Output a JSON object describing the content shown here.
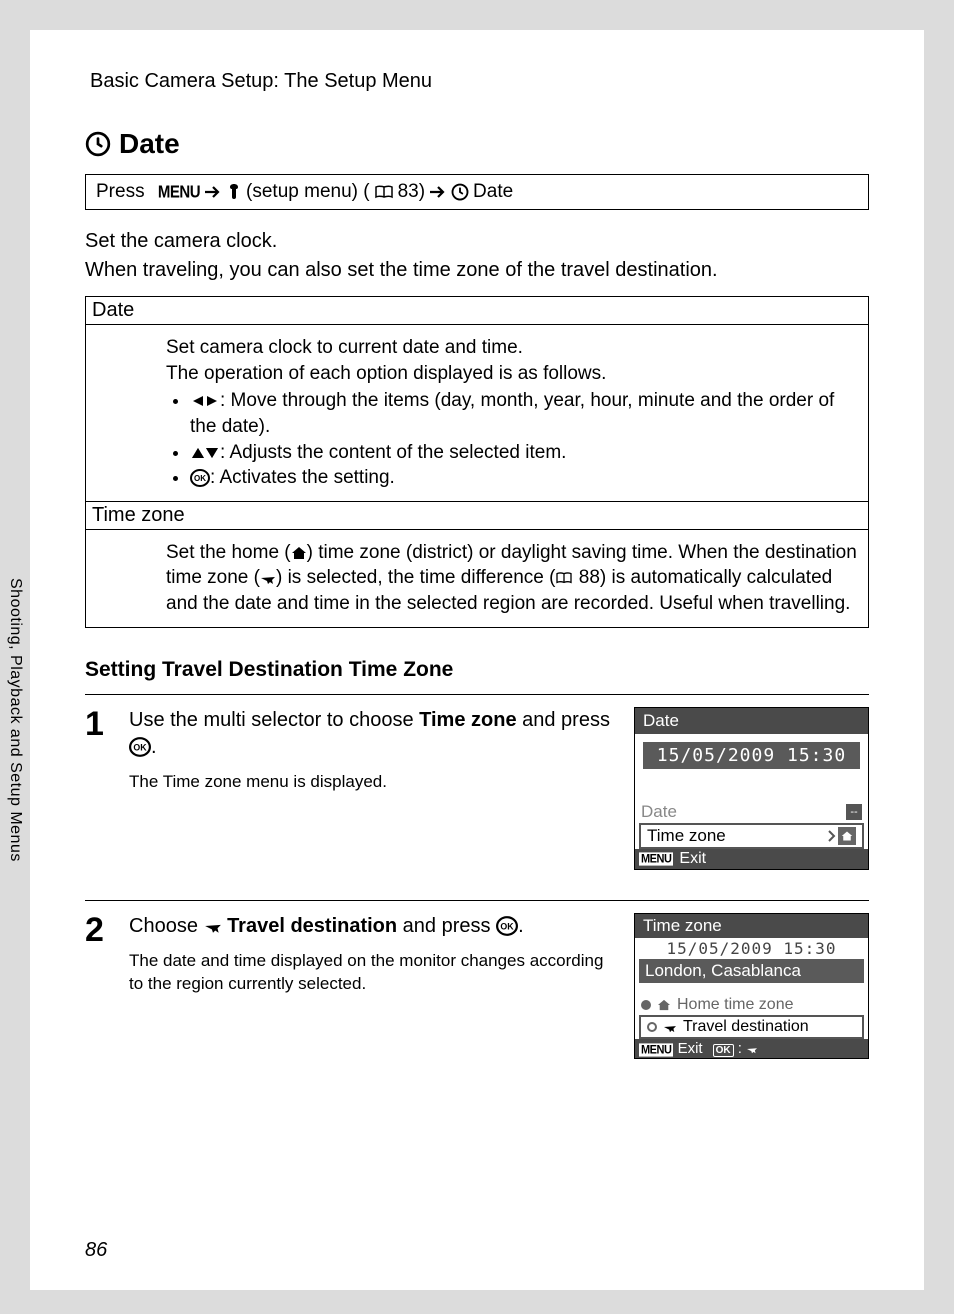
{
  "breadcrumb": "Basic Camera Setup: The Setup Menu",
  "h1": "Date",
  "nav": {
    "press": "Press",
    "menu": "MENU",
    "setup_menu": "(setup menu) (",
    "pageref": "83)",
    "date": "Date"
  },
  "intro1": "Set the camera clock.",
  "intro2": "When traveling, you can also set the time zone of the travel destination.",
  "table": {
    "row1": {
      "header": "Date",
      "p1": "Set camera clock to current date and time.",
      "p2": "The operation of each option displayed is as follows.",
      "li1": ": Move through the items (day, month, year, hour, minute and the order of the date).",
      "li2": ": Adjusts the content of the selected item.",
      "li3": ": Activates the setting."
    },
    "row2": {
      "header": "Time zone",
      "p1a": "Set the home (",
      "p1b": ") time zone (district) or daylight saving time. When the destination time zone (",
      "p1c": ") is selected, the time difference (",
      "p1d": "88) is automatically calculated and the date and time in the selected region are recorded. Useful when travelling."
    }
  },
  "sub_heading": "Setting Travel Destination Time Zone",
  "step1": {
    "num": "1",
    "lead_a": "Use the multi selector to choose ",
    "lead_bold": "Time zone",
    "lead_b": " and press ",
    "sub": "The Time zone menu is displayed.",
    "screen": {
      "title": "Date",
      "datetime": "15/05/2009 15:30",
      "opt1": "Date",
      "opt1v": "--",
      "opt2": "Time zone",
      "exit": "Exit"
    }
  },
  "step2": {
    "num": "2",
    "lead_a": "Choose ",
    "lead_bold": "Travel destination",
    "lead_b": " and press ",
    "sub": "The date and time displayed on the monitor changes according to the region currently selected.",
    "screen": {
      "title": "Time zone",
      "datetime": "15/05/2009 15:30",
      "loc": "London, Casablanca",
      "opt1": "Home time zone",
      "opt2": "Travel destination",
      "exit": "Exit"
    }
  },
  "side_tab": "Shooting, Playback and Setup Menus",
  "page_number": "86"
}
